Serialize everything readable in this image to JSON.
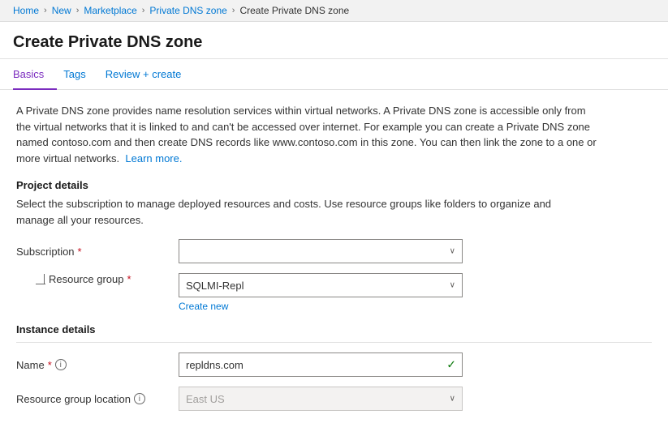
{
  "breadcrumb": {
    "items": [
      {
        "label": "Home",
        "link": true
      },
      {
        "label": "New",
        "link": true
      },
      {
        "label": "Marketplace",
        "link": true
      },
      {
        "label": "Private DNS zone",
        "link": true
      },
      {
        "label": "Create Private DNS zone",
        "link": false
      }
    ]
  },
  "page": {
    "title": "Create Private DNS zone"
  },
  "tabs": [
    {
      "label": "Basics",
      "active": true
    },
    {
      "label": "Tags",
      "active": false
    },
    {
      "label": "Review + create",
      "active": false
    }
  ],
  "description": {
    "main": "A Private DNS zone provides name resolution services within virtual networks. A Private DNS zone is accessible only from the virtual networks that it is linked to and can't be accessed over internet. For example you can create a Private DNS zone named contoso.com and then create DNS records like www.contoso.com in this zone. You can then link the zone to a one or more virtual networks.",
    "learn_more": "Learn more."
  },
  "sections": {
    "project_details": {
      "heading": "Project details",
      "description": "Select the subscription to manage deployed resources and costs. Use resource groups like folders to organize and manage all your resources."
    },
    "instance_details": {
      "heading": "Instance details"
    }
  },
  "form": {
    "subscription": {
      "label": "Subscription",
      "required": true,
      "value": "",
      "placeholder": ""
    },
    "resource_group": {
      "label": "Resource group",
      "required": true,
      "value": "SQLMI-Repl",
      "create_new": "Create new"
    },
    "name": {
      "label": "Name",
      "required": true,
      "value": "repldns.com",
      "info": true
    },
    "resource_group_location": {
      "label": "Resource group location",
      "value": "East US",
      "info": true,
      "disabled": true
    }
  },
  "icons": {
    "chevron": "∨",
    "check": "✓",
    "info": "i",
    "separator": "›"
  }
}
